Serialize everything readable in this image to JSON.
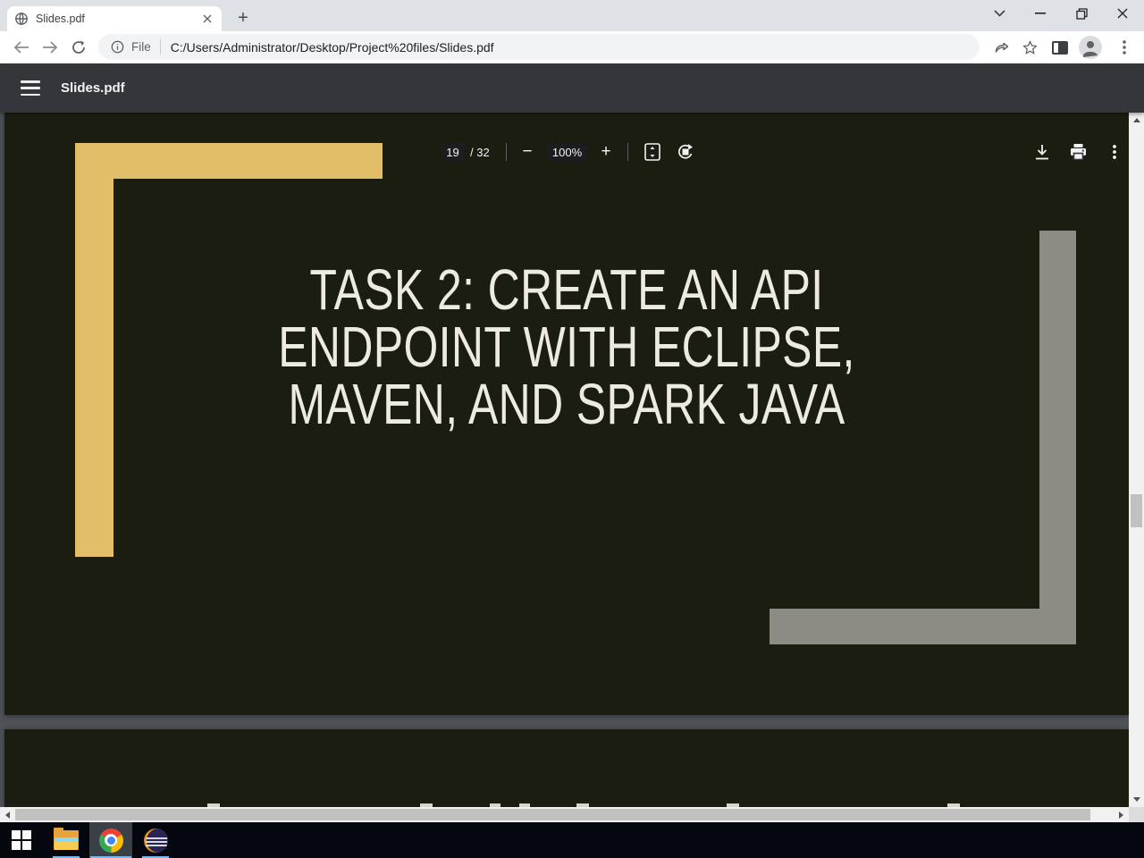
{
  "browser": {
    "tab": {
      "title": "Slides.pdf"
    },
    "new_tab_glyph": "+",
    "address": {
      "scheme": "File",
      "url": "C:/Users/Administrator/Desktop/Project%20files/Slides.pdf"
    }
  },
  "pdf": {
    "toolbar": {
      "title": "Slides.pdf",
      "page_current": "19",
      "page_total": "/ 32",
      "zoom": "100%",
      "zoom_out_glyph": "−",
      "zoom_in_glyph": "+"
    }
  },
  "slide": {
    "title_line1": "TASK 2: CREATE AN API",
    "title_line2": "ENDPOINT WITH ECLIPSE,",
    "title_line3": "MAVEN, AND SPARK JAVA",
    "colors": {
      "background": "#1C1D11",
      "text": "#EDEBDF",
      "accent_yellow": "#E2BE69",
      "accent_gray": "#8C8C85"
    }
  },
  "taskbar": {
    "apps": [
      "windows-start",
      "file-explorer",
      "chrome",
      "eclipse"
    ]
  }
}
